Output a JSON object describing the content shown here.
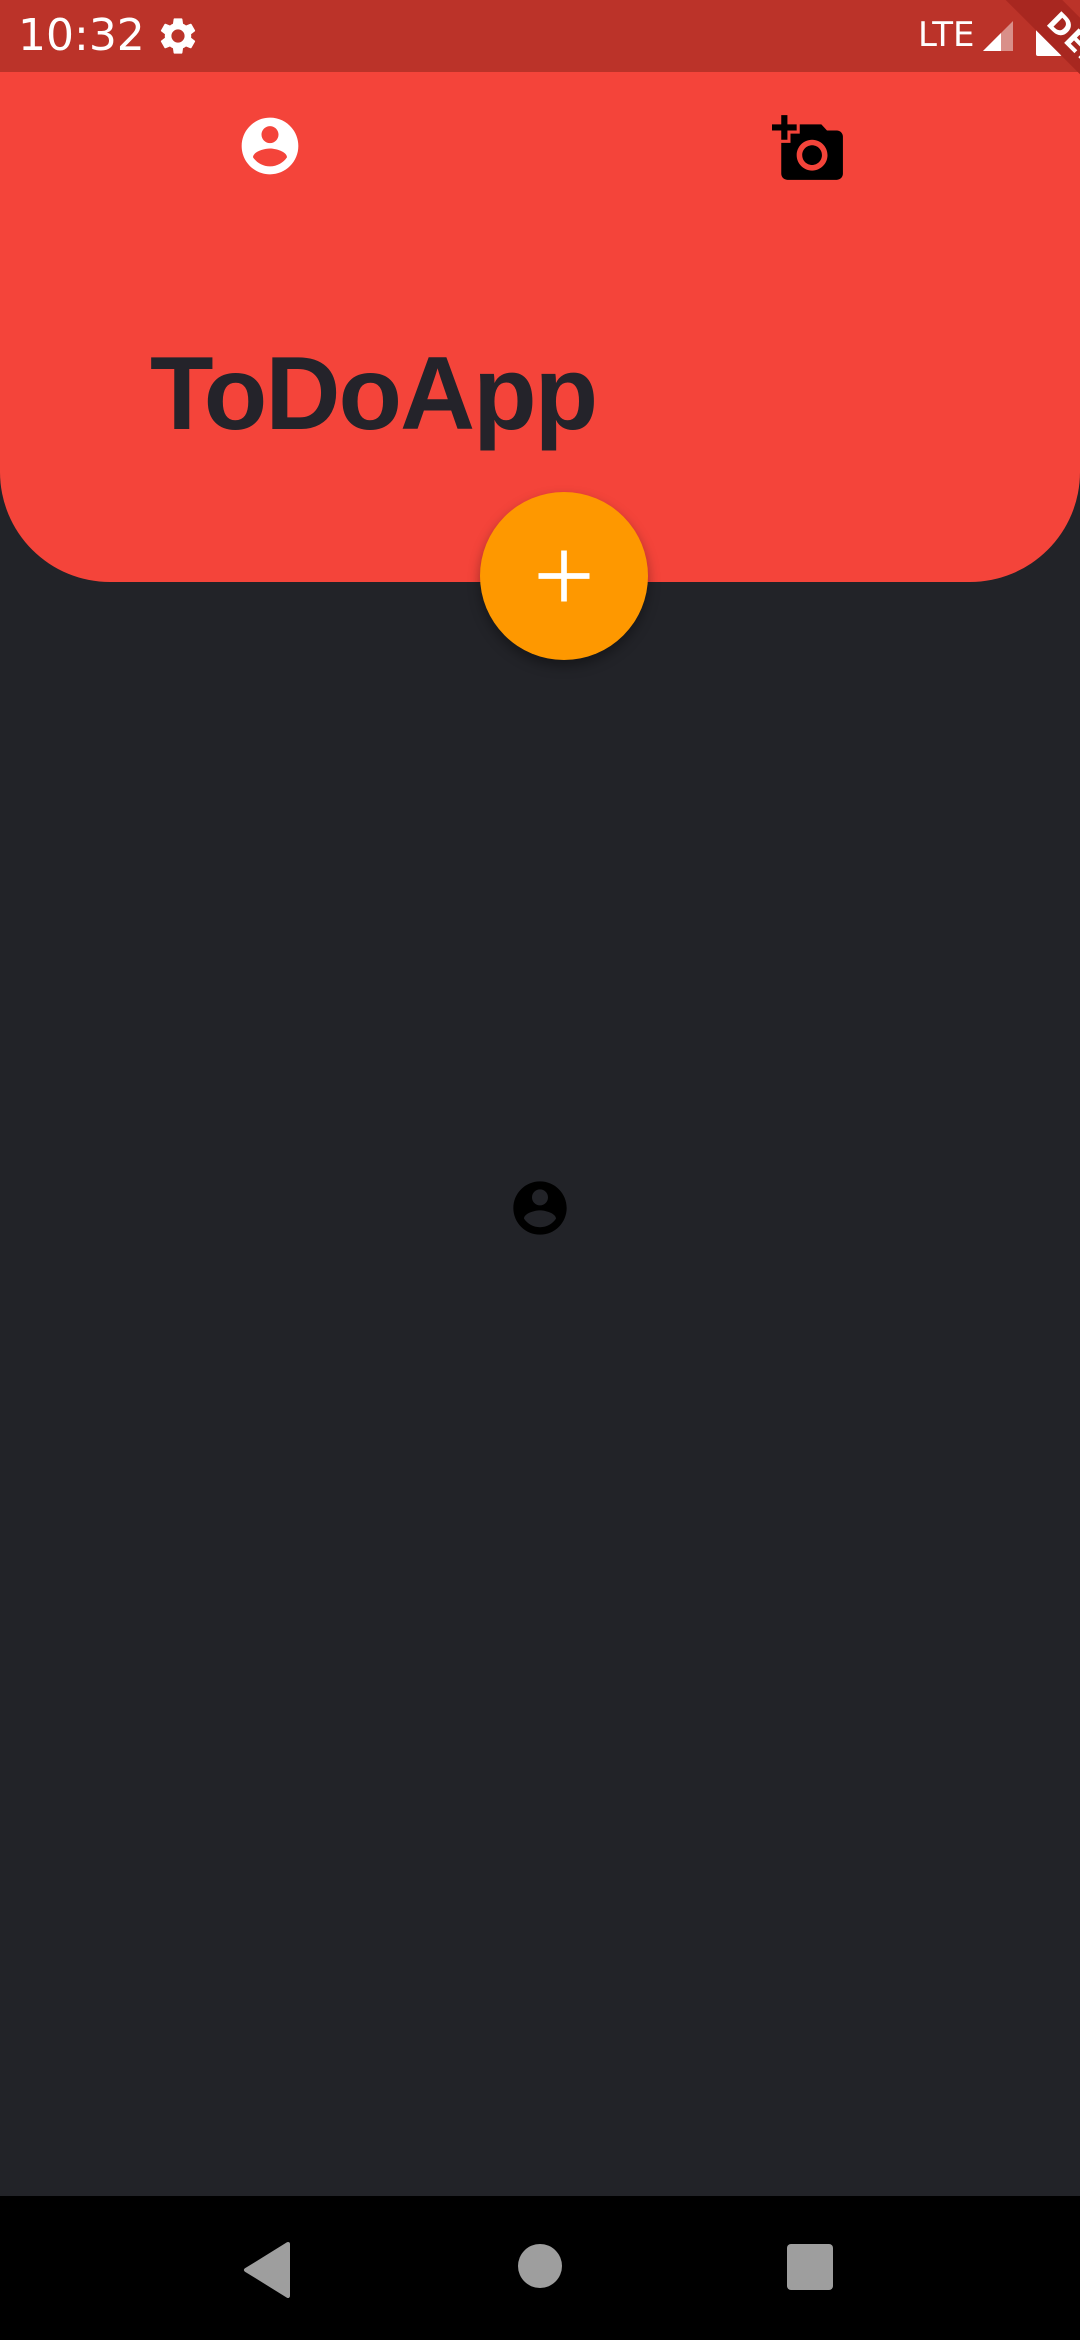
{
  "status_bar": {
    "time": "10:32",
    "network": "LTE",
    "settings_icon": "gear-icon",
    "signal_icon": "signal-icon",
    "battery_icon": "battery-icon"
  },
  "header": {
    "title": "ToDoApp",
    "left_icon": "account-circle-icon",
    "right_icon": "add-a-photo-icon"
  },
  "fab": {
    "icon": "plus-icon"
  },
  "body": {
    "center_icon": "account-circle-icon"
  },
  "debug_banner": {
    "label": "DEBUG"
  },
  "nav_bar": {
    "back_icon": "back-triangle-icon",
    "home_icon": "home-circle-icon",
    "recents_icon": "recents-square-icon"
  },
  "colors": {
    "status_bar": "#bb3329",
    "header": "#f4443a",
    "background": "#222328",
    "fab": "#fe9800",
    "title_text": "#24232a",
    "debug_ribbon": "#a82720"
  }
}
